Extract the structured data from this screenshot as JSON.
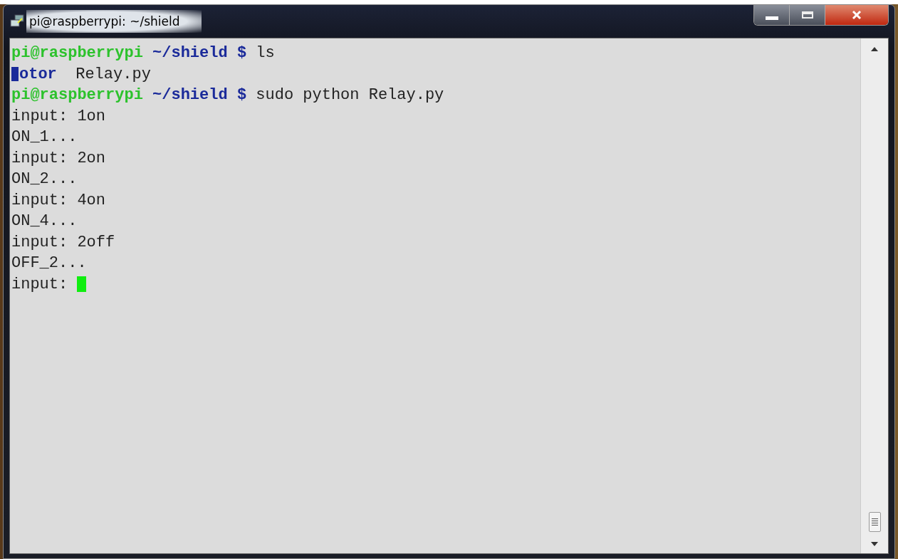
{
  "window": {
    "title": "pi@raspberrypi: ~/shield"
  },
  "terminal": {
    "lines": [
      {
        "segments": [
          {
            "kind": "user",
            "text": "pi@raspberrypi"
          },
          {
            "kind": "path",
            "text": "~/shield"
          },
          {
            "kind": "sign",
            "text": "$"
          },
          {
            "kind": "plain",
            "text": "ls"
          }
        ]
      },
      {
        "segments": [
          {
            "kind": "block"
          },
          {
            "kind": "dir",
            "text": "otor"
          },
          {
            "kind": "plain",
            "text": " Relay.py"
          }
        ]
      },
      {
        "segments": [
          {
            "kind": "user",
            "text": "pi@raspberrypi"
          },
          {
            "kind": "path",
            "text": "~/shield"
          },
          {
            "kind": "sign",
            "text": "$"
          },
          {
            "kind": "plain",
            "text": "sudo python Relay.py"
          }
        ]
      },
      {
        "segments": [
          {
            "kind": "plain",
            "text": "input: 1on"
          }
        ]
      },
      {
        "segments": [
          {
            "kind": "plain",
            "text": "ON_1..."
          }
        ]
      },
      {
        "segments": [
          {
            "kind": "plain",
            "text": "input: 2on"
          }
        ]
      },
      {
        "segments": [
          {
            "kind": "plain",
            "text": "ON_2..."
          }
        ]
      },
      {
        "segments": [
          {
            "kind": "plain",
            "text": "input: 4on"
          }
        ]
      },
      {
        "segments": [
          {
            "kind": "plain",
            "text": "ON_4..."
          }
        ]
      },
      {
        "segments": [
          {
            "kind": "plain",
            "text": "input: 2off"
          }
        ]
      },
      {
        "segments": [
          {
            "kind": "plain",
            "text": "OFF_2..."
          }
        ]
      },
      {
        "segments": [
          {
            "kind": "plain",
            "text": "input:"
          },
          {
            "kind": "cursor"
          }
        ]
      }
    ]
  }
}
